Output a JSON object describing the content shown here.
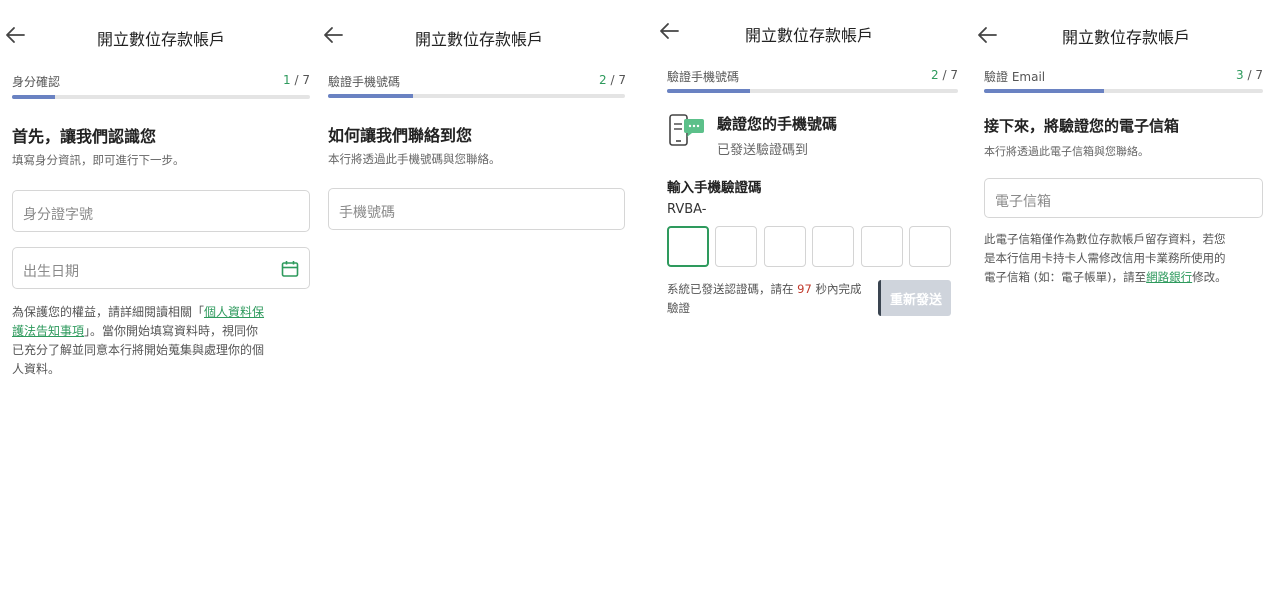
{
  "screens": [
    {
      "title": "開立數位存款帳戶",
      "step_label": "身分確認",
      "step_current": "1",
      "step_total": "/ 7",
      "progress": 0.143,
      "heading": "首先，讓我們認識您",
      "subtitle": "填寫身分資訊，即可進行下一步。",
      "id_placeholder": "身分證字號",
      "dob_placeholder": "出生日期",
      "note_line1_prefix": "為保護您的權益，請詳細閱讀相關「",
      "note_link_part1": "個人資料保",
      "note_link_part2": "護法告知事項",
      "note_line2_suffix": "」。當你開始填寫資料時，視同你",
      "note_line3": "已充分了解並同意本行將開始蒐集與處理你的個",
      "note_line4": "人資料。"
    },
    {
      "title": "開立數位存款帳戶",
      "step_label": "驗證手機號碼",
      "step_current": "2",
      "step_total": "/ 7",
      "progress": 0.286,
      "heading": "如何讓我們聯絡到您",
      "subtitle": "本行將透過此手機號碼與您聯絡。",
      "phone_placeholder": "手機號碼"
    },
    {
      "title": "開立數位存款帳戶",
      "step_label": "驗證手機號碼",
      "step_current": "2",
      "step_total": "/ 7",
      "progress": 0.286,
      "sms_title": "驗證您的手機號碼",
      "sms_sub": "已發送驗證碼到",
      "otp_label": "輸入手機驗證碼",
      "otp_prefix": "RVBA-",
      "sent_text_prefix": "系統已發送認證碼，請在",
      "countdown": "97",
      "sent_text_suffix": "秒內完成",
      "sent_text_line2": "驗證",
      "resend_label": "重新發送"
    },
    {
      "title": "開立數位存款帳戶",
      "step_label": "驗證 Email",
      "step_current": "3",
      "step_total": "/ 7",
      "progress": 0.429,
      "heading": "接下來，將驗證您的電子信箱",
      "subtitle": "本行將透過此電子信箱與您聯絡。",
      "email_placeholder": "電子信箱",
      "note_line1": "此電子信箱僅作為數位存款帳戶留存資料，若您",
      "note_line2": "是本行信用卡持卡人需修改信用卡業務所使用的",
      "note_line3_prefix": "電子信箱 (如：電子帳單)，請至",
      "note_link": "網路銀行",
      "note_line3_suffix": "修改。"
    }
  ],
  "icons": {
    "back": "arrow-left-icon",
    "calendar": "calendar-icon",
    "sms": "phone-sms-icon"
  },
  "colors": {
    "accent_green": "#2e9a5d",
    "progress_blue": "#6a82c2",
    "countdown_red": "#c0392b"
  }
}
